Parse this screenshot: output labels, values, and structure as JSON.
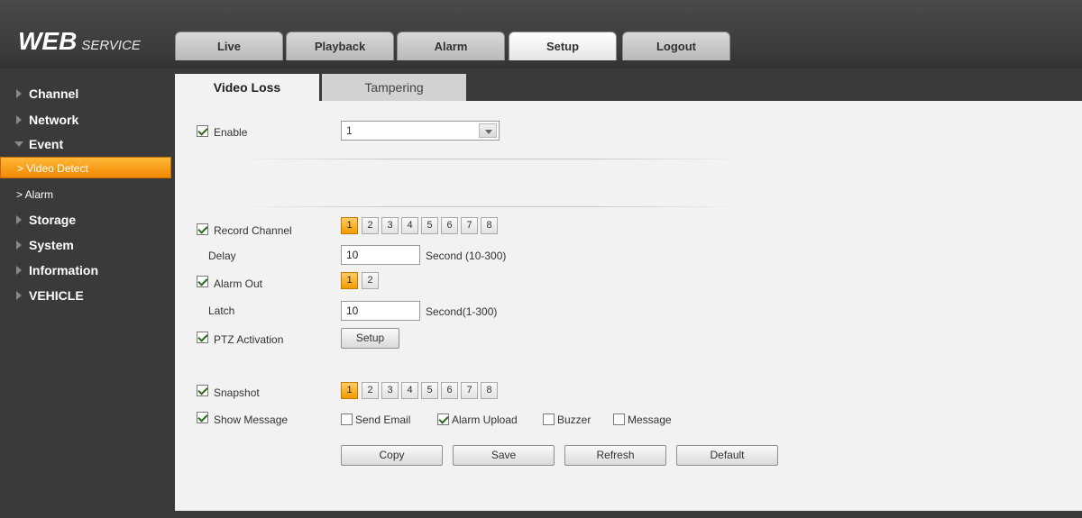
{
  "brand": {
    "main": "WEB",
    "sub": "SERVICE"
  },
  "topnav": [
    {
      "label": "Live",
      "active": false
    },
    {
      "label": "Playback",
      "active": false
    },
    {
      "label": "Alarm",
      "active": false
    },
    {
      "label": "Setup",
      "active": true
    },
    {
      "label": "Logout",
      "active": false
    }
  ],
  "sidebar": {
    "channel": "Channel",
    "network": "Network",
    "event": "Event",
    "video_detect": "> Video Detect",
    "alarm": "> Alarm",
    "storage": "Storage",
    "system": "System",
    "information": "Information",
    "vehicle": "VEHICLE"
  },
  "subtabs": {
    "video_loss": "Video Loss",
    "tampering": "Tampering"
  },
  "form": {
    "enable": {
      "label": "Enable",
      "checked": true,
      "value": "1"
    },
    "record_channel": {
      "label": "Record Channel",
      "checked": true,
      "buttons": [
        "1",
        "2",
        "3",
        "4",
        "5",
        "6",
        "7",
        "8"
      ],
      "selected": [
        "1"
      ]
    },
    "delay": {
      "label": "Delay",
      "value": "10",
      "unit": "Second (10-300)"
    },
    "alarm_out": {
      "label": "Alarm Out",
      "checked": true,
      "buttons": [
        "1",
        "2"
      ],
      "selected": [
        "1"
      ]
    },
    "latch": {
      "label": "Latch",
      "value": "10",
      "unit": "Second(1-300)"
    },
    "ptz": {
      "label": "PTZ Activation",
      "checked": true,
      "button": "Setup"
    },
    "snapshot": {
      "label": "Snapshot",
      "checked": true,
      "buttons": [
        "1",
        "2",
        "3",
        "4",
        "5",
        "6",
        "7",
        "8"
      ],
      "selected": [
        "1"
      ]
    },
    "show_message": {
      "label": "Show Message",
      "checked": true
    },
    "options": {
      "send_email": {
        "label": "Send Email",
        "checked": false
      },
      "alarm_upload": {
        "label": "Alarm Upload",
        "checked": true
      },
      "buzzer": {
        "label": "Buzzer",
        "checked": false
      },
      "message": {
        "label": "Message",
        "checked": false
      }
    }
  },
  "actions": {
    "copy": "Copy",
    "save": "Save",
    "refresh": "Refresh",
    "default": "Default"
  },
  "colors": {
    "accent": "#f29a00",
    "header_bg": "#3a3a3a",
    "content_bg": "#f2f2f2"
  }
}
